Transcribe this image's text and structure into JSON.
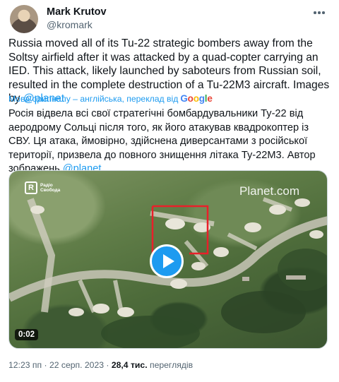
{
  "author": {
    "name": "Mark Krutov",
    "handle": "@kromark"
  },
  "tweet": {
    "text_main": "Russia moved all of its Tu-22 strategic bombers away from the Soltsy airfield after it was attacked by a quad-copter carrying an IED. This attack, likely launched by saboteurs from Russian soil, resulted in the complete destruction of a Tu-22M3 aircraft. Images by ",
    "mention": "@planet"
  },
  "translation": {
    "label": "Мова оригіналу – англійська, переклад від",
    "provider": "Google",
    "text_main": "Росія відвела всі свої стратегічні бомбардувальники Ту-22 від аеродрому Сольці після того, як його атакував квадрокоптер із СВУ. Ця атака, ймовірно, здійснена диверсантами з російської території, призвела до повного знищення літака Ту-22М3. Автор зображень ",
    "mention": "@planet"
  },
  "media": {
    "logo_name": "Радіо Свобода",
    "logo_mark": "R",
    "watermark": "Planet.com",
    "duration": "0:02",
    "highlight_color": "#e8202a"
  },
  "meta": {
    "time": "12:23 пп",
    "separator": " · ",
    "date": "22 серп. 2023",
    "separator2": " · ",
    "views_count": "28,4 тис.",
    "views_label": " переглядів"
  },
  "icons": {
    "more": "more-dots-icon",
    "play": "play-icon"
  }
}
